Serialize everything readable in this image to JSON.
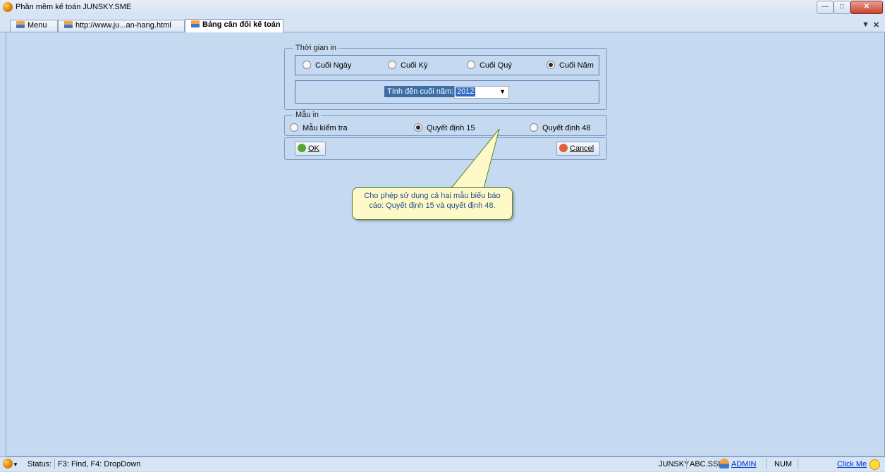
{
  "window": {
    "title": "Phần mềm kế toán JUNSKY.SME"
  },
  "tabs": [
    {
      "label": "Menu"
    },
    {
      "label": "http://www.ju...an-hang.html"
    },
    {
      "label": "Bảng cân đối kế toán"
    }
  ],
  "form": {
    "time_group": {
      "legend": "Thời gian in",
      "options": [
        "Cuối Ngày",
        "Cuối Kỳ",
        "Cuối Quý",
        "Cuối Năm"
      ],
      "selected": "Cuối Năm",
      "year_label": "Tính đến cuối năm:",
      "year_value": "2012"
    },
    "template_group": {
      "legend": "Mẫu in",
      "options": [
        "Mẫu kiểm tra",
        "Quyết định 15",
        "Quyết định 48"
      ],
      "selected": "Quyết định 15"
    },
    "ok_label": "OK",
    "cancel_label": "Cancel"
  },
  "callout": {
    "line1": "Cho phép sử dụng cả hai mẫu biểu báo",
    "line2": "cáo: Quyết định 15 và quyết định 48."
  },
  "status": {
    "prefix": "Status:",
    "hint": "F3: Find, F4: DropDown",
    "company": "JUNSKY",
    "database": "ABC.SSE",
    "user": "ADMIN",
    "numlock": "NUM",
    "click_me": "Click Me"
  },
  "colors": {
    "background": "#c5d9f1",
    "accent": "#3a6ea5",
    "callout_bg": "#fff9c9",
    "callout_border": "#4e8a2a"
  }
}
